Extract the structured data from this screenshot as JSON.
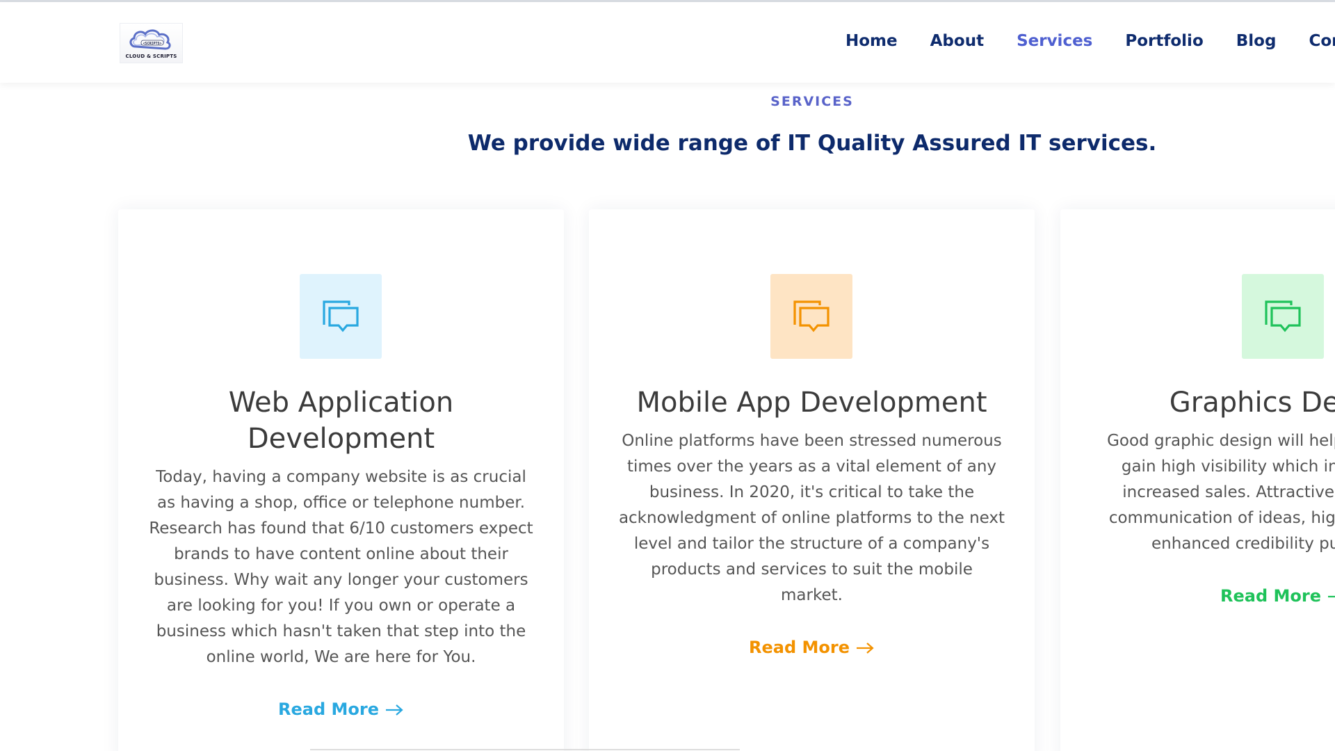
{
  "header": {
    "logo_text": "CLOUD & SCRIPTS",
    "logo_badge": "<SCRIPTS>",
    "nav": [
      {
        "label": "Home",
        "active": false
      },
      {
        "label": "About",
        "active": false
      },
      {
        "label": "Services",
        "active": true
      },
      {
        "label": "Portfolio",
        "active": false
      },
      {
        "label": "Blog",
        "active": false
      },
      {
        "label": "Contact",
        "active": false
      }
    ]
  },
  "section": {
    "eyebrow": "SERVICES",
    "headline": "We provide wide range of IT Quality Assured IT services."
  },
  "cards": [
    {
      "title": "Web Application Development",
      "description": "Today, having a company website is as crucial as having a shop, office or telephone number. Research has found that 6/10 customers expect brands to have content online about their business. Why wait any longer your customers are looking for you! If you own or operate a business which hasn't taken that step into the online world, We are here for You.",
      "read_more": "Read More",
      "accent": "#29a8e0",
      "icon_bg": "#dff3fd",
      "icon": "chat-bubbles-icon"
    },
    {
      "title": "Mobile App Development",
      "description": "Online platforms have been stressed numerous times over the years as a vital element of any business. In 2020, it's critical to take the acknowledgment of online platforms to the next level and tailor the structure of a company's products and services to suit the mobile market.",
      "read_more": "Read More",
      "accent": "#f39200",
      "icon_bg": "#fee4c4",
      "icon": "chat-bubbles-icon"
    },
    {
      "title": "Graphics Design",
      "description": "Good graphic design will help your business gain high visibility which in turn leads to increased sales. Attractive visuals, clear communication of ideas, higher impact and enhanced credibility push traffic.",
      "read_more": "Read More",
      "accent": "#1fc25a",
      "icon_bg": "#d5f8dd",
      "icon": "chat-bubbles-icon"
    }
  ]
}
